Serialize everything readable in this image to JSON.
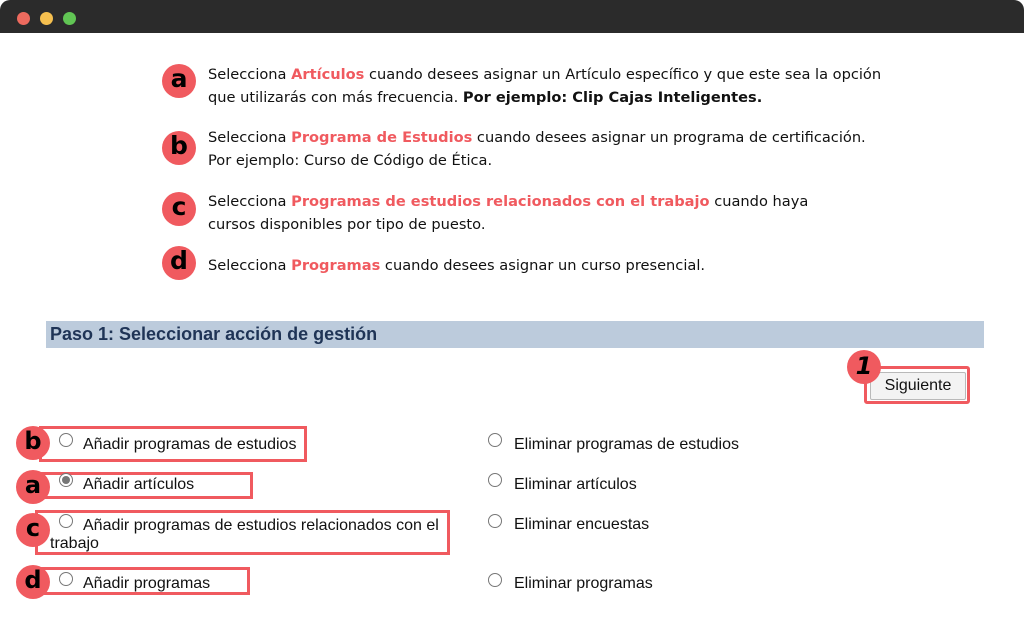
{
  "instructions": [
    {
      "badge": "a",
      "pre": "Selecciona ",
      "highlight": "Artículos",
      "post": " cuando desees asignar un Artículo específico y que este sea la opción que utilizarás con más frecuencia. ",
      "bold": "Por ejemplo: Clip Cajas Inteligentes."
    },
    {
      "badge": "b",
      "pre": "Selecciona ",
      "highlight": "Programa de Estudios",
      "post": " cuando desees asignar un programa de certificación. Por ejemplo: Curso de Código de Ética.",
      "bold": ""
    },
    {
      "badge": "c",
      "pre": "Selecciona ",
      "highlight": "Programas de estudios relacionados con el trabajo",
      "post": " cuando haya cursos disponibles por tipo de puesto.",
      "bold": ""
    },
    {
      "badge": "d",
      "pre": "Selecciona ",
      "highlight": "Programas",
      "post": " cuando desees asignar un curso presencial.",
      "bold": ""
    }
  ],
  "step_title": "Paso 1: Seleccionar acción de gestión",
  "next_button": "Siguiente",
  "next_badge": "1",
  "options_left": [
    {
      "badge": "b",
      "label": "Añadir programas de estudios",
      "checked": false
    },
    {
      "badge": "a",
      "label": "Añadir artículos",
      "checked": true
    },
    {
      "badge": "c",
      "label": "Añadir programas de estudios relacionados con el trabajo",
      "checked": false
    },
    {
      "badge": "d",
      "label": "Añadir programas",
      "checked": false
    }
  ],
  "options_right": [
    {
      "label": "Eliminar programas de estudios",
      "checked": false
    },
    {
      "label": "Eliminar artículos",
      "checked": false
    },
    {
      "label": "Eliminar encuestas",
      "checked": false
    },
    {
      "label": "Eliminar programas",
      "checked": false
    }
  ],
  "colors": {
    "accent": "#f05a5f",
    "header_bg": "#bccbdc",
    "header_text": "#1f3456",
    "titlebar": "#2b2b2b"
  }
}
